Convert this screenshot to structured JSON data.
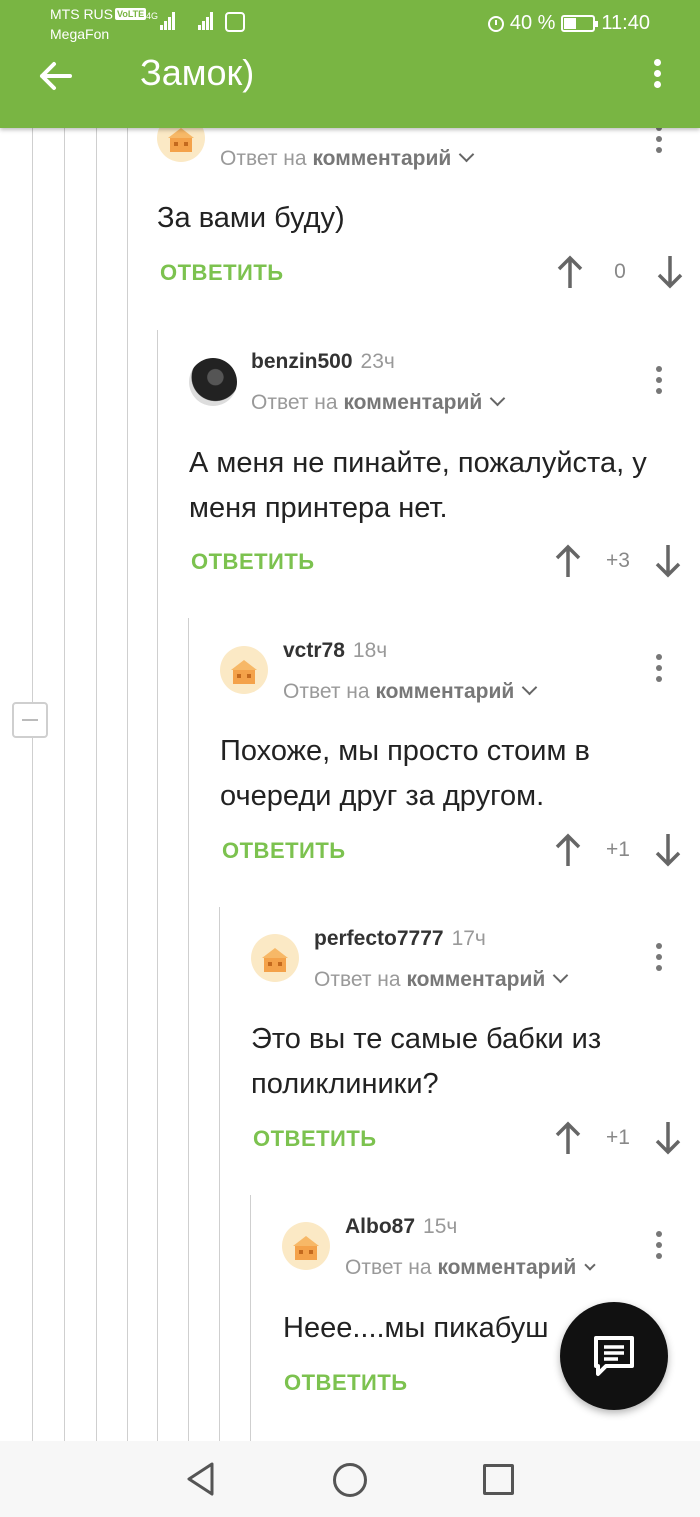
{
  "status_bar": {
    "carrier1": "MTS RUS",
    "volte": "VoLTE",
    "network": "4G",
    "carrier2": "MegaFon",
    "battery": "40 %",
    "time": "11:40"
  },
  "header": {
    "title": "Замок)",
    "back_icon": "arrow-left-icon",
    "menu_icon": "more-vertical-icon"
  },
  "comments": [
    {
      "username": "",
      "time": "",
      "reply_prefix": "Ответ на",
      "reply_link": "комментарий",
      "text": "За вами буду)",
      "reply_label": "ОТВЕТИТЬ",
      "score": "0"
    },
    {
      "username": "benzin500",
      "time": "23ч",
      "reply_prefix": "Ответ на",
      "reply_link": "комментарий",
      "text": "А меня не пинайте, пожалуйста, у меня принтера нет.",
      "reply_label": "ОТВЕТИТЬ",
      "score": "+3"
    },
    {
      "username": "vctr78",
      "time": "18ч",
      "reply_prefix": "Ответ на",
      "reply_link": "комментарий",
      "text": "Похоже, мы просто стоим в очереди друг за другом.",
      "reply_label": "ОТВЕТИТЬ",
      "score": "+1"
    },
    {
      "username": "perfecto7777",
      "time": "17ч",
      "reply_prefix": "Ответ на",
      "reply_link": "комментарий",
      "text": "Это вы те самые бабки из поликлиники?",
      "reply_label": "ОТВЕТИТЬ",
      "score": "+1"
    },
    {
      "username": "Albo87",
      "time": "15ч",
      "reply_prefix": "Ответ на",
      "reply_link": "комментарий",
      "text": "Неее....мы пикабуш",
      "reply_label": "ОТВЕТИТЬ",
      "score": ""
    }
  ],
  "fab": {
    "icon": "comment-icon"
  },
  "nav": {
    "back_icon": "nav-back-icon",
    "home_icon": "nav-home-icon",
    "recent_icon": "nav-recent-icon"
  },
  "colors": {
    "accent": "#79b543",
    "reply": "#7cc24f",
    "fab": "#111111"
  }
}
